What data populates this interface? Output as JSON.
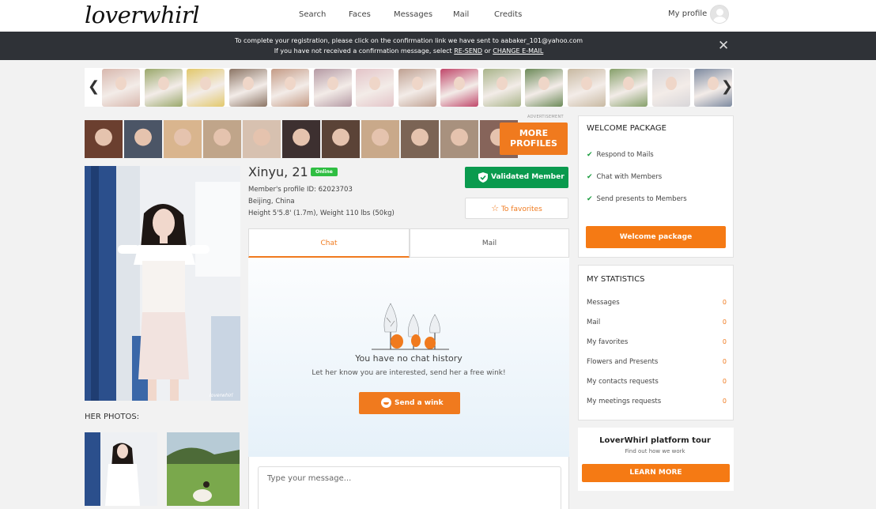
{
  "header": {
    "logo": "loverwhirl",
    "nav": [
      "Search",
      "Faces",
      "Messages",
      "Mail",
      "Credits"
    ],
    "my_profile": "My profile"
  },
  "banner": {
    "line1": "To complete your registration, please click on the confirmation link we have sent to aabaker_101@yahoo.com",
    "line2_prefix": "If you have not received a confirmation message, select",
    "resend": "RE-SEND",
    "or": "or",
    "change_email": "CHANGE E-MAIL"
  },
  "carousel": {
    "thumb_colors": [
      "#d8b8ae",
      "#9aa86b",
      "#e2c86b",
      "#8c7565",
      "#c49b86",
      "#b59aa4",
      "#e3c4c8",
      "#bfa192",
      "#c0476a",
      "#a9b48a",
      "#6c8a58",
      "#c8b9a2",
      "#86a06a",
      "#d8d6d9",
      "#7d8aa0"
    ]
  },
  "faces": {
    "advertisement": "ADVERTISEMENT",
    "face_colors": [
      "#6b3f2f",
      "#4b5566",
      "#d9b58e",
      "#c0a58a",
      "#d7c1b0",
      "#3d3030",
      "#5b4337",
      "#c9a98a",
      "#7b6455",
      "#a8917e",
      "#86645a"
    ],
    "more_profiles": [
      "MORE",
      "PROFILES"
    ]
  },
  "profile": {
    "name": "Xinyu, 21",
    "online": "Online",
    "member_id": "Member's profile ID: 62023703",
    "location": "Beijing, China",
    "stats": "Height 5'5.8' (1.7m), Weight 110 lbs (50kg)",
    "validated": "Validated Member",
    "to_favorites": "To favorites",
    "her_photos": "HER PHOTOS:",
    "watermark": "loverwhirl"
  },
  "chat": {
    "tabs": [
      "Chat",
      "Mail"
    ],
    "empty_title": "You have no chat history",
    "empty_sub": "Let her know you are interested, send her a free wink!",
    "wink_button": "Send a wink",
    "input_placeholder": "Type your message..."
  },
  "welcome": {
    "title": "WELCOME PACKAGE",
    "items": [
      "Respond to Mails",
      "Chat with Members",
      "Send presents to Members"
    ],
    "button": "Welcome package"
  },
  "statistics": {
    "title": "MY STATISTICS",
    "rows": [
      {
        "label": "Messages",
        "value": "0"
      },
      {
        "label": "Mail",
        "value": "0"
      },
      {
        "label": "My favorites",
        "value": "0"
      },
      {
        "label": "Flowers and Presents",
        "value": "0"
      },
      {
        "label": "My contacts requests",
        "value": "0"
      },
      {
        "label": "My meetings requests",
        "value": "0"
      }
    ]
  },
  "tour": {
    "title": "LoverWhirl platform tour",
    "subtitle": "Find out how we work",
    "button": "LEARN MORE"
  },
  "colors": {
    "accent": "#f07a1e",
    "validated": "#0a9a4e",
    "online": "#2fbe42",
    "banner": "#2f3237"
  }
}
